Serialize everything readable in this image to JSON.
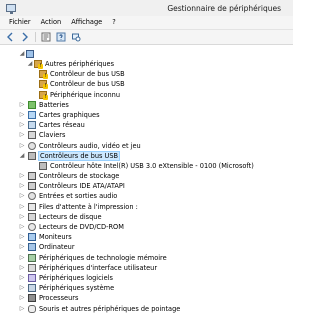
{
  "window": {
    "title": "Gestionnaire de périphériques"
  },
  "menu": {
    "file": "Fichier",
    "action": "Action",
    "view": "Affichage",
    "help": "?"
  },
  "tree": {
    "root_icon": "computer-icon",
    "items": [
      {
        "label": "Autres périphériques",
        "icon": "warning-device-icon",
        "expanded": true,
        "level": 1
      },
      {
        "label": "Contrôleur de bus USB",
        "icon": "warning-device-icon",
        "level": 2
      },
      {
        "label": "Contrôleur de bus USB",
        "icon": "warning-device-icon",
        "level": 2
      },
      {
        "label": "Périphérique inconnu",
        "icon": "warning-device-icon",
        "level": 2
      },
      {
        "label": "Batteries",
        "icon": "battery-icon",
        "level": 1
      },
      {
        "label": "Cartes graphiques",
        "icon": "display-adapter-icon",
        "level": 1
      },
      {
        "label": "Cartes réseau",
        "icon": "network-adapter-icon",
        "level": 1
      },
      {
        "label": "Claviers",
        "icon": "keyboard-icon",
        "level": 1
      },
      {
        "label": "Contrôleurs audio, vidéo et jeu",
        "icon": "audio-icon",
        "level": 1
      },
      {
        "label": "Contrôleurs de bus USB",
        "icon": "usb-icon",
        "expanded": true,
        "selected": true,
        "level": 1
      },
      {
        "label": "Contrôleur hôte Intel(R) USB 3.0 eXtensible - 0100 (Microsoft)",
        "icon": "usb-device-icon",
        "level": 2
      },
      {
        "label": "Contrôleurs de stockage",
        "icon": "storage-icon",
        "level": 1
      },
      {
        "label": "Contrôleurs IDE ATA/ATAPI",
        "icon": "ide-icon",
        "level": 1
      },
      {
        "label": "Entrées et sorties audio",
        "icon": "audio-io-icon",
        "level": 1
      },
      {
        "label": "Files d'attente à l'impression :",
        "icon": "print-queue-icon",
        "level": 1
      },
      {
        "label": "Lecteurs de disque",
        "icon": "disk-drive-icon",
        "level": 1
      },
      {
        "label": "Lecteurs de DVD/CD-ROM",
        "icon": "dvd-icon",
        "level": 1
      },
      {
        "label": "Moniteurs",
        "icon": "monitor-icon",
        "level": 1
      },
      {
        "label": "Ordinateur",
        "icon": "computer-icon",
        "level": 1
      },
      {
        "label": "Périphériques de technologie mémoire",
        "icon": "memory-icon",
        "level": 1
      },
      {
        "label": "Périphériques d'interface utilisateur",
        "icon": "hid-icon",
        "level": 1
      },
      {
        "label": "Périphériques logiciels",
        "icon": "software-device-icon",
        "level": 1
      },
      {
        "label": "Périphériques système",
        "icon": "system-device-icon",
        "level": 1
      },
      {
        "label": "Processeurs",
        "icon": "processor-icon",
        "level": 1
      },
      {
        "label": "Souris et autres périphériques de pointage",
        "icon": "mouse-icon",
        "level": 1
      }
    ]
  },
  "colors": {
    "selection_bg": "#cce8ff",
    "selection_border": "#99d1ff",
    "chrome_bg": "#f0f0f0"
  }
}
